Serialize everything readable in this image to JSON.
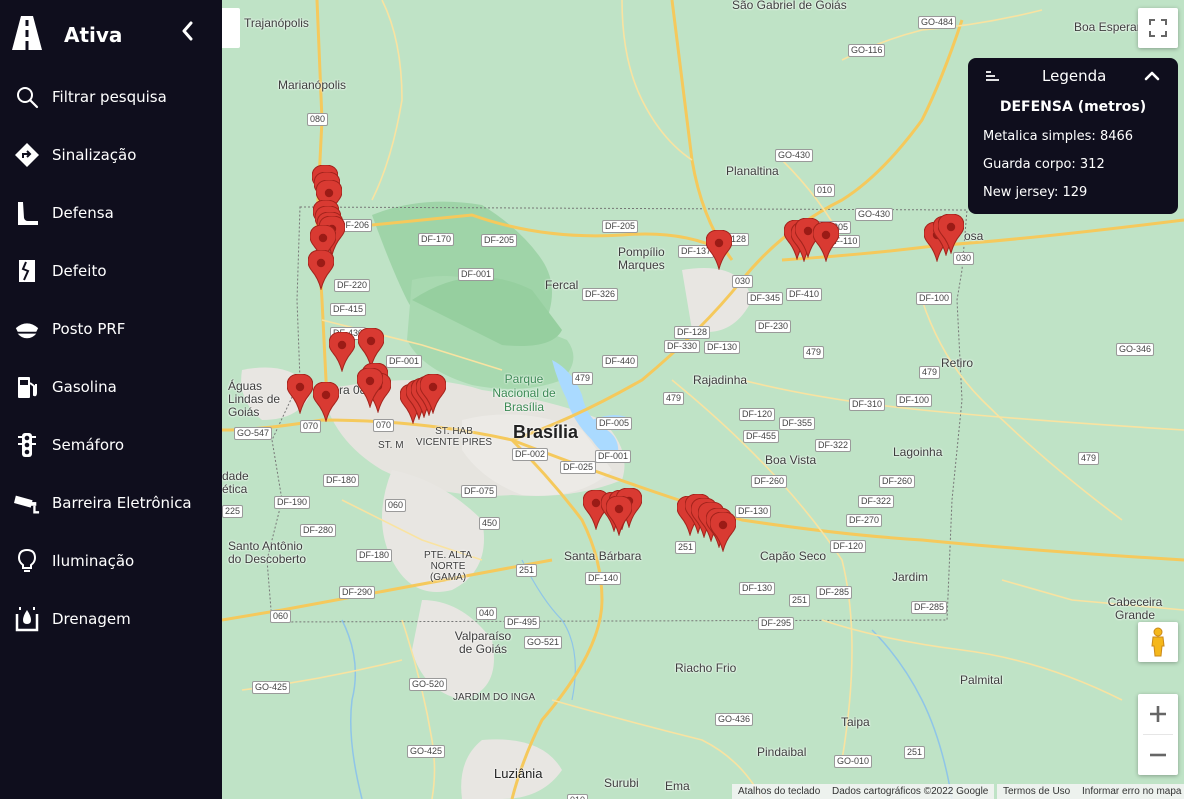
{
  "app": {
    "title": "Ativa"
  },
  "sidebar": {
    "items": [
      {
        "label": "Filtrar pesquisa",
        "icon": "search-icon"
      },
      {
        "label": "Sinalização",
        "icon": "road-sign-icon"
      },
      {
        "label": "Defensa",
        "icon": "guardrail-icon"
      },
      {
        "label": "Defeito",
        "icon": "road-defect-icon"
      },
      {
        "label": "Posto PRF",
        "icon": "police-cap-icon"
      },
      {
        "label": "Gasolina",
        "icon": "fuel-pump-icon"
      },
      {
        "label": "Semáforo",
        "icon": "traffic-light-icon"
      },
      {
        "label": "Barreira Eletrônica",
        "icon": "speed-camera-icon"
      },
      {
        "label": "Iluminação",
        "icon": "lightbulb-icon"
      },
      {
        "label": "Drenagem",
        "icon": "drainage-icon"
      }
    ]
  },
  "legend": {
    "title": "Legenda",
    "subtitle": "DEFENSA (metros)",
    "rows": [
      {
        "label": "Metalica simples: 8466"
      },
      {
        "label": "Guarda corpo: 312"
      },
      {
        "label": "New jersey: 129"
      }
    ]
  },
  "map": {
    "places": {
      "brasilia": "Brasília",
      "trajanopolis": "Trajanópolis",
      "marianopolis": "Marianópolis",
      "sao_gabriel": "São Gabriel de Goiás",
      "boa_esperanca": "Boa Esperan",
      "planaltina": "Planaltina",
      "pompilio": "Pompílio Marques",
      "fercal": "Fercal",
      "parque": "Parque Nacional de Brasília",
      "incra": "Incra 08",
      "aguas_lindas": "Águas Lindas de Goiás",
      "st_hab": "ST. HAB VICENTE PIRES",
      "st_m": "ST. M",
      "rajadinha": "Rajadinha",
      "retiro": "Retiro",
      "lagoinha": "Lagoinha",
      "boa_vista": "Boa Vista",
      "santa_barbara": "Santa Bárbara",
      "capao_seco": "Capão Seco",
      "jardim": "Jardim",
      "santo_antonio": "Santo Antônio do Descoberto",
      "pte_alta": "PTE. ALTA NORTE (GAMA)",
      "valparaiso": "Valparaíso de Goiás",
      "jardim_inga": "JARDIM DO INGA",
      "riacho_frio": "Riacho Frio",
      "cabeceira": "Cabeceira Grande",
      "palmital": "Palmital",
      "taipa": "Taipa",
      "pindaibal": "Pindaibal",
      "luziania": "Luziânia",
      "surubi": "Surubi",
      "ema": "Ema",
      "cidade_etica": "dade ética",
      "formosa": "osa"
    },
    "roads": {
      "go484": "GO-484",
      "go116": "GO-116",
      "go430a": "GO-430",
      "go430b": "GO-430",
      "r010": "010",
      "r080": "080",
      "df206": "DF-206",
      "df170": "DF-170",
      "df205a": "DF-205",
      "df205b": "DF-205",
      "df205c": "DF-205",
      "df001a": "DF-001",
      "df001b": "DF-001",
      "df001c": "DF-001",
      "df220": "DF-220",
      "df415": "DF-415",
      "df430": "DF-430",
      "df326": "DF-326",
      "df128a": "DF-128",
      "df128b": "DF-128",
      "df345": "DF-345",
      "df410": "DF-410",
      "df230": "DF-230",
      "df330": "DF-330",
      "df130a": "DF-130",
      "df440": "DF-440",
      "r479a": "479",
      "r479b": "479",
      "r479c": "479",
      "r479d": "479",
      "r479e": "479",
      "r030a": "030",
      "r030b": "030",
      "df100a": "DF-100",
      "df100b": "DF-100",
      "go346": "GO-346",
      "df310": "DF-310",
      "df120a": "DF-120",
      "df355": "DF-355",
      "df455": "DF-455",
      "df322a": "DF-322",
      "df322b": "DF-322",
      "df260a": "DF-260",
      "df260b": "DF-260",
      "df005": "DF-005",
      "df002": "DF-002",
      "df025": "DF-025",
      "df075": "DF-075",
      "df180a": "DF-180",
      "df180b": "DF-180",
      "df190": "DF-190",
      "df280": "DF-280",
      "df290": "DF-290",
      "df140": "DF-140",
      "df495": "DF-495",
      "go521": "GO-521",
      "go425a": "GO-425",
      "go425b": "GO-425",
      "go520": "GO-520",
      "go547": "GO-547",
      "r070a": "070",
      "r070b": "070",
      "r060a": "060",
      "r060b": "060",
      "r450": "450",
      "r251a": "251",
      "r251b": "251",
      "r251c": "251",
      "r251d": "251",
      "r040": "040",
      "df130b": "DF-130",
      "df130c": "DF-130",
      "df270": "DF-270",
      "df120b": "DF-120",
      "df285a": "DF-285",
      "df285b": "DF-285",
      "df295": "DF-295",
      "go436": "GO-436",
      "go010": "GO-010",
      "r010b": "010",
      "df110": "DF-110",
      "df137": "DF-137",
      "r225": "225"
    },
    "attribution": {
      "shortcuts": "Atalhos do teclado",
      "data": "Dados cartográficos ©2022 Google",
      "terms": "Termos de Uso",
      "report": "Informar erro no mapa"
    }
  },
  "colors": {
    "sidebar_bg": "#0f0e1d",
    "marker": "#d93a32",
    "map_bg": "#bfe3c6"
  }
}
